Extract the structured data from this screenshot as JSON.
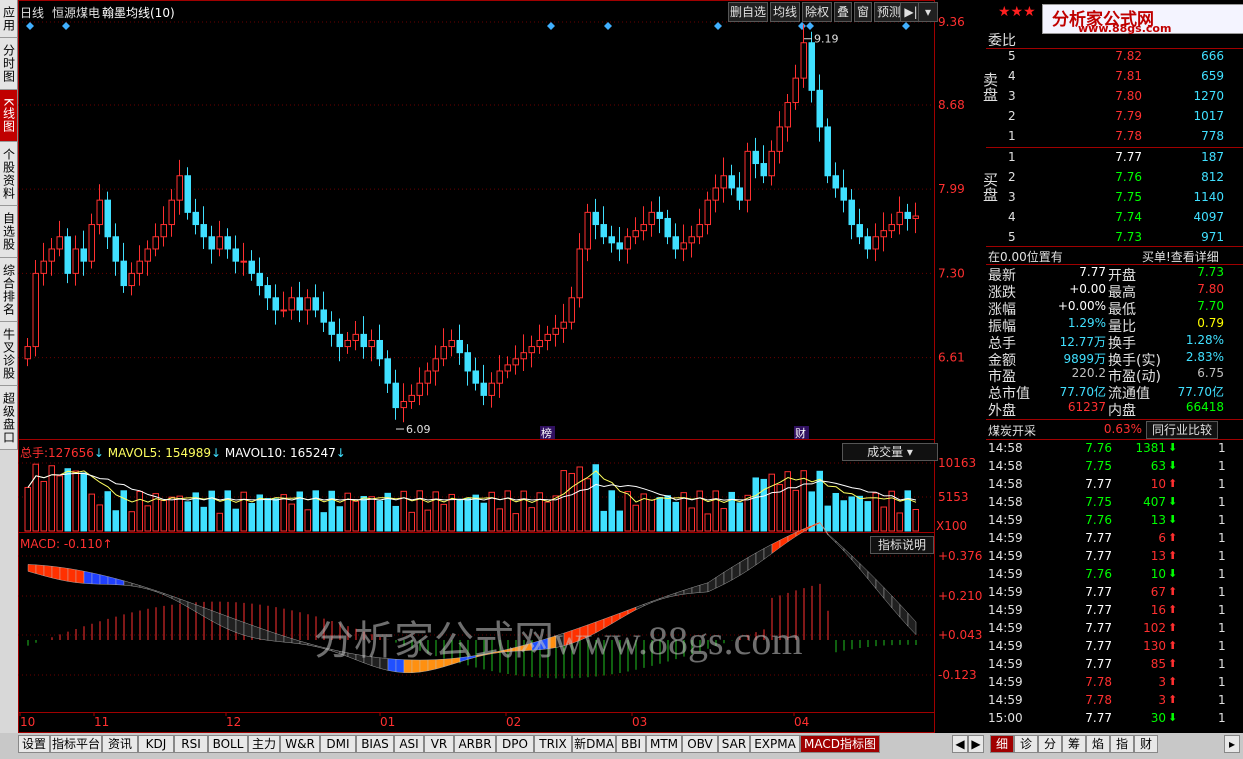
{
  "left_tabs": [
    {
      "label": "应用",
      "h": 38
    },
    {
      "label": "分时图",
      "h": 52
    },
    {
      "label": "K线图",
      "h": 52,
      "active": true
    },
    {
      "label": "个股资料",
      "h": 64
    },
    {
      "label": "自选股",
      "h": 52
    },
    {
      "label": "综合排名",
      "h": 64
    },
    {
      "label": "牛叉诊股",
      "h": 64
    },
    {
      "label": "超级盘口",
      "h": 64
    }
  ],
  "header": {
    "period": "日线",
    "stock": "恒源煤电",
    "indicator": "翰墨均线(10)"
  },
  "toolbar": [
    "删自选",
    "均线",
    "除权",
    "叠",
    "窗",
    "预测"
  ],
  "price_axis": [
    "9.36",
    "8.68",
    "7.99",
    "7.30",
    "6.61"
  ],
  "annotations": {
    "high": "9.19",
    "low": "6.09",
    "badge1": "榜",
    "badge2": "财"
  },
  "volume": {
    "label_prefix": "总手:",
    "value": "127656",
    "mavol5_label": "MAVOL5:",
    "mavol5": "154989",
    "mavol10_label": "MAVOL10:",
    "mavol10": "165247",
    "dropdown": "成交量",
    "axis": [
      "10163",
      "5153"
    ],
    "unit": "X100"
  },
  "macd": {
    "label": "MACD: -0.110",
    "explain": "指标说明",
    "axis": [
      "+0.376",
      "+0.210",
      "+0.043",
      "-0.123"
    ]
  },
  "watermark": "分析家公式网www.88gs.com",
  "date_axis": [
    "10",
    "11",
    "12",
    "01",
    "02",
    "03",
    "04"
  ],
  "bottom_tabs": [
    "设置",
    "指标平台",
    "资讯",
    "KDJ",
    "RSI",
    "BOLL",
    "主力",
    "W&R",
    "DMI",
    "BIAS",
    "ASI",
    "VR",
    "ARBR",
    "DPO",
    "TRIX",
    "新DMA",
    "BBI",
    "MTM",
    "OBV",
    "SAR",
    "EXPMA",
    "MACD指标图"
  ],
  "right_bottom_tabs": [
    "细",
    "诊",
    "分",
    "筹",
    "焰",
    "指",
    "财"
  ],
  "logo": {
    "text": "分析家公式网",
    "url": "www.88gs.com"
  },
  "panel": {
    "weibi": "委比",
    "sell_label": "卖盘",
    "buy_label": "买盘",
    "sell": [
      {
        "lvl": "5",
        "price": "7.82",
        "vol": "666"
      },
      {
        "lvl": "4",
        "price": "7.81",
        "vol": "659"
      },
      {
        "lvl": "3",
        "price": "7.80",
        "vol": "1270"
      },
      {
        "lvl": "2",
        "price": "7.79",
        "vol": "1017"
      },
      {
        "lvl": "1",
        "price": "7.78",
        "vol": "778"
      }
    ],
    "buy": [
      {
        "lvl": "1",
        "price": "7.77",
        "vol": "187"
      },
      {
        "lvl": "2",
        "price": "7.76",
        "vol": "812"
      },
      {
        "lvl": "3",
        "price": "7.75",
        "vol": "1140"
      },
      {
        "lvl": "4",
        "price": "7.74",
        "vol": "4097"
      },
      {
        "lvl": "5",
        "price": "7.73",
        "vol": "971"
      }
    ],
    "pos_text": "在0.00位置有",
    "buy_detail": "买单!查看详细",
    "stats": [
      {
        "k1": "最新",
        "v1": "7.77",
        "k2": "开盘",
        "v2": "7.73",
        "c1": "#ffffff",
        "c2": "#00ff00"
      },
      {
        "k1": "涨跌",
        "v1": "+0.00",
        "k2": "最高",
        "v2": "7.80",
        "c1": "#ffffff",
        "c2": "#ff3030"
      },
      {
        "k1": "涨幅",
        "v1": "+0.00%",
        "k2": "最低",
        "v2": "7.70",
        "c1": "#ffffff",
        "c2": "#00ff00"
      },
      {
        "k1": "振幅",
        "v1": "1.29%",
        "k2": "量比",
        "v2": "0.79",
        "c1": "#40e0ff",
        "c2": "#ffff00"
      },
      {
        "k1": "总手",
        "v1": "12.77万",
        "k2": "换手",
        "v2": "1.28%",
        "c1": "#40e0ff",
        "c2": "#40e0ff"
      },
      {
        "k1": "金额",
        "v1": "9899万",
        "k2": "换手(实)",
        "v2": "2.83%",
        "c1": "#40e0ff",
        "c2": "#40e0ff"
      },
      {
        "k1": "市盈",
        "v1": "220.2",
        "k2": "市盈(动)",
        "v2": "6.75",
        "c1": "#c0c0c0",
        "c2": "#c0c0c0"
      },
      {
        "k1": "总市值",
        "v1": "77.70亿",
        "k2": "流通值",
        "v2": "77.70亿",
        "c1": "#40e0ff",
        "c2": "#40e0ff"
      },
      {
        "k1": "外盘",
        "v1": "61237",
        "k2": "内盘",
        "v2": "66418",
        "c1": "#ff3030",
        "c2": "#00ff00"
      }
    ],
    "sector": "煤炭开采",
    "sector_pct": "0.63%",
    "compare": "同行业比较",
    "ticks": [
      {
        "t": "14:58",
        "p": "7.76",
        "v": "1381",
        "d": "down",
        "n": "1"
      },
      {
        "t": "14:58",
        "p": "7.75",
        "v": "63",
        "d": "down",
        "n": "1"
      },
      {
        "t": "14:58",
        "p": "7.77",
        "v": "10",
        "d": "up",
        "n": "1"
      },
      {
        "t": "14:58",
        "p": "7.75",
        "v": "407",
        "d": "down",
        "n": "1"
      },
      {
        "t": "14:59",
        "p": "7.76",
        "v": "13",
        "d": "down",
        "n": "1"
      },
      {
        "t": "14:59",
        "p": "7.77",
        "v": "6",
        "d": "up",
        "n": "1"
      },
      {
        "t": "14:59",
        "p": "7.77",
        "v": "13",
        "d": "up",
        "n": "1"
      },
      {
        "t": "14:59",
        "p": "7.76",
        "v": "10",
        "d": "down",
        "n": "1"
      },
      {
        "t": "14:59",
        "p": "7.77",
        "v": "67",
        "d": "up",
        "n": "1"
      },
      {
        "t": "14:59",
        "p": "7.77",
        "v": "16",
        "d": "up",
        "n": "1"
      },
      {
        "t": "14:59",
        "p": "7.77",
        "v": "102",
        "d": "up",
        "n": "1"
      },
      {
        "t": "14:59",
        "p": "7.77",
        "v": "130",
        "d": "up",
        "n": "1"
      },
      {
        "t": "14:59",
        "p": "7.77",
        "v": "85",
        "d": "up",
        "n": "1"
      },
      {
        "t": "14:59",
        "p": "7.78",
        "v": "3",
        "d": "up",
        "n": "1"
      },
      {
        "t": "14:59",
        "p": "7.78",
        "v": "3",
        "d": "up",
        "n": "1"
      },
      {
        "t": "15:00",
        "p": "7.77",
        "v": "30",
        "d": "down",
        "n": "1"
      }
    ]
  },
  "chart_data": {
    "type": "candlestick",
    "price_range": [
      6.09,
      9.19
    ],
    "note_ticks": [
      "9.36",
      "8.68",
      "7.99",
      "7.30",
      "6.61"
    ],
    "closes": [
      6.7,
      7.3,
      7.4,
      7.5,
      7.6,
      7.3,
      7.5,
      7.4,
      7.7,
      7.9,
      7.6,
      7.4,
      7.2,
      7.3,
      7.4,
      7.5,
      7.6,
      7.7,
      7.9,
      8.1,
      7.8,
      7.7,
      7.6,
      7.5,
      7.6,
      7.5,
      7.4,
      7.4,
      7.3,
      7.2,
      7.1,
      7.0,
      7.0,
      7.1,
      7.0,
      7.1,
      7.0,
      6.9,
      6.8,
      6.7,
      6.75,
      6.8,
      6.7,
      6.75,
      6.6,
      6.4,
      6.2,
      6.25,
      6.3,
      6.4,
      6.5,
      6.6,
      6.7,
      6.75,
      6.65,
      6.5,
      6.4,
      6.3,
      6.4,
      6.5,
      6.55,
      6.6,
      6.65,
      6.7,
      6.75,
      6.8,
      6.85,
      6.9,
      7.1,
      7.5,
      7.8,
      7.7,
      7.6,
      7.55,
      7.5,
      7.6,
      7.65,
      7.7,
      7.8,
      7.75,
      7.6,
      7.5,
      7.55,
      7.6,
      7.7,
      7.9,
      8.0,
      8.1,
      8.0,
      7.9,
      8.3,
      8.2,
      8.1,
      8.3,
      8.5,
      8.7,
      8.9,
      9.19,
      8.8,
      8.5,
      8.1,
      8.0,
      7.9,
      7.7,
      7.6,
      7.5,
      7.6,
      7.65,
      7.7,
      7.8,
      7.75,
      7.77
    ],
    "volume_max": 10163,
    "macd_range": [
      -0.123,
      0.376
    ]
  }
}
